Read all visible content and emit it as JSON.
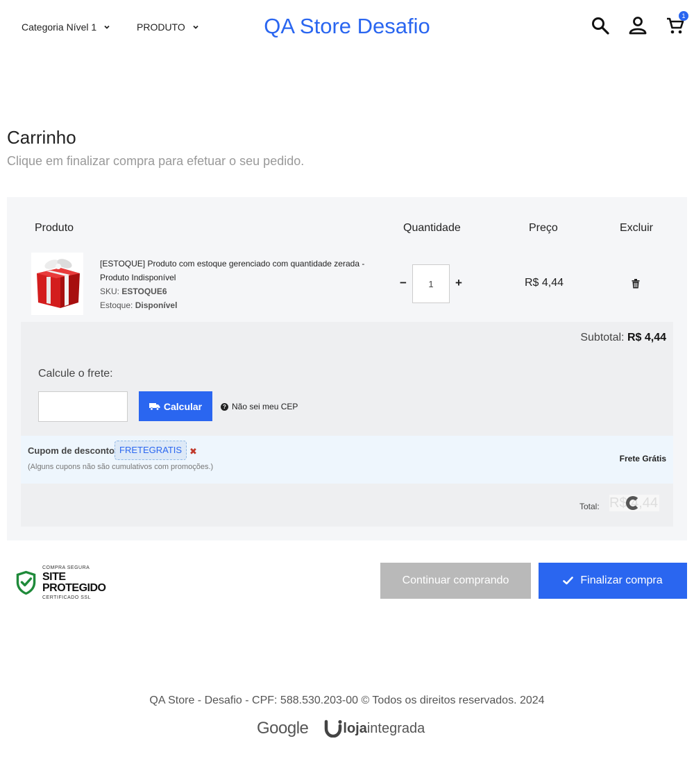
{
  "header": {
    "nav": [
      {
        "label": "Categoria Nível 1"
      },
      {
        "label": "PRODUTO"
      }
    ],
    "store_name": "QA Store Desafio",
    "cart_count": "1"
  },
  "page": {
    "title": "Carrinho",
    "subtitle": "Clique em finalizar compra para efetuar o seu pedido."
  },
  "cart": {
    "columns": {
      "product": "Produto",
      "quantity": "Quantidade",
      "price": "Preço",
      "remove": "Excluir"
    },
    "item": {
      "name": "[ESTOQUE] Produto com estoque gerenciado com quantidade zerada - Produto Indisponível",
      "sku_label": "SKU:",
      "sku": "ESTOQUE6",
      "stock_label": "Estoque:",
      "stock": "Disponível",
      "quantity": "1",
      "price": "R$ 4,44"
    },
    "subtotal_label": "Subtotal:",
    "subtotal": "R$ 4,44",
    "shipping": {
      "label": "Calcule o frete:",
      "cep_value": "",
      "calc_button": "Calcular",
      "cep_help": "Não sei meu CEP"
    },
    "coupon": {
      "label": "Cupom de desconto:",
      "code": "FRETEGRATIS",
      "remove": "✖",
      "note": "(Alguns cupons não são cumulativos com promoções.)",
      "benefit": "Frete Grátis"
    },
    "total_label": "Total:",
    "total": "R$ 4,44"
  },
  "actions": {
    "continue": "Continuar comprando",
    "finish": "Finalizar compra"
  },
  "seal": {
    "top": "COMPRA SEGURA",
    "main": "SITE PROTEGIDO",
    "bottom": "CERTIFICADO SSL"
  },
  "footer": {
    "text": "QA Store - Desafio - CPF: 588.530.203-00 © Todos os direitos reservados. 2024",
    "google": "Google",
    "loja_bold": "loja",
    "loja_rest": "integrada"
  },
  "colors": {
    "accent": "#2a66f0",
    "panel": "#f5f6f8",
    "coupon_bg": "#eef6fd",
    "disabled_button": "#b9b9b9"
  }
}
